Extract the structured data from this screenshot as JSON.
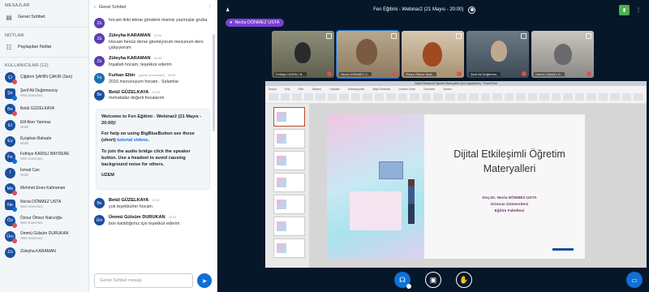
{
  "sidebar": {
    "messages_title": "MESAJLAR",
    "public_chat": "Genel Sohbet",
    "notes_title": "NOTLAR",
    "shared_notes": "Paylaşılan Notlar",
    "users_title": "KULLANICILAR (12)",
    "users": [
      {
        "initials": "Çi",
        "name": "Çiğdem ŞAHİN ÇAKIR (Sen)",
        "role": "",
        "mic": "off",
        "moderator": false
      },
      {
        "initials": "Şe",
        "name": "Şerif Ali Değirmenciy",
        "role": "Web Kamerası",
        "mic": "on",
        "moderator": true
      },
      {
        "initials": "Be",
        "name": "Betül GÜZELKAYA",
        "role": "",
        "mic": "off",
        "moderator": false
      },
      {
        "initials": "El",
        "name": "Elif Aker Yanmaz",
        "role": "Mobil",
        "mic": "",
        "moderator": false
      },
      {
        "initials": "Ey",
        "name": "Eyüphan Bahadır",
        "role": "Mobil",
        "mic": "",
        "moderator": false
      },
      {
        "initials": "Fe",
        "name": "Fethiye KARSLI BAYDERE",
        "role": "Web Kamerası",
        "mic": "on",
        "moderator": false
      },
      {
        "initials": "İ",
        "name": "İsmail Can",
        "role": "Mobil",
        "mic": "",
        "moderator": false
      },
      {
        "initials": "Me",
        "name": "Mehmet Enes Kahraman",
        "role": "",
        "mic": "off",
        "moderator": false
      },
      {
        "initials": "Ne",
        "name": "Necla DÖNMEZ USTA",
        "role": "Web Kamerası",
        "mic": "on",
        "moderator": true
      },
      {
        "initials": "Öz",
        "name": "Öznur Ölmez Nalcıoğlu",
        "role": "Web Kamerası",
        "mic": "off",
        "moderator": false
      },
      {
        "initials": "Üm",
        "name": "Ümmü Gülsüm DURUKAN",
        "role": "Web Kamerası",
        "mic": "off",
        "moderator": false
      },
      {
        "initials": "Zü",
        "name": "Züleyha KARAMAN",
        "role": "",
        "mic": "",
        "moderator": false
      }
    ]
  },
  "chat": {
    "header": "Genel Sohbet",
    "messages": [
      {
        "initials": "Zü",
        "name": "",
        "time": "",
        "text": "hocam linki tekrar gönderir misiniz yazmışlar gruba",
        "avatar_color": "#5b3fb0"
      },
      {
        "initials": "Zü",
        "name": "Züleyha KARAMAN",
        "time": "20:04",
        "text": "Hocam henüz derse giremiyorum mezunum ders çalışıyorum",
        "avatar_color": "#5b3fb0"
      },
      {
        "initials": "Zü",
        "name": "Züleyha KARAMAN",
        "time": "20:05",
        "text": "İnşallah hocam, teşekkür ederim",
        "avatar_color": "#5b3fb0"
      },
      {
        "initials": "Fu",
        "name": "Furkan Elbir",
        "time": "20:05",
        "sub": "(ayrıldı oturumdan)",
        "text": "2016 mezunuyum hocam . Selamlar",
        "avatar_color": "#1b6fb0"
      },
      {
        "initials": "Be",
        "name": "Betül GÜZELKAYA",
        "time": "20:06",
        "text": "mehabalar değerli hocalarım",
        "avatar_color": "#1b4f9e"
      }
    ],
    "welcome": {
      "line1": "Welcome to Fen Eğitimi - Webinar2 (21 Mayıs - 20:00)!",
      "line2a": "For help on using BigBlueButton see these (short) ",
      "line2link": "tutorial videos",
      "line2b": ".",
      "line3": "To join the audio bridge click the speaker button. Use a headset to avoid causing background noise for others.",
      "line4": "UZEM"
    },
    "messages2": [
      {
        "initials": "Be",
        "name": "Betül GÜZELKAYA",
        "time": "20:42",
        "text": "çok teşekkürler hocam",
        "avatar_color": "#1b4f9e"
      },
      {
        "initials": "Üm",
        "name": "Ümmü Gülsüm DURUKAN",
        "time": "20:43",
        "text": "bon katıldığımız için teşekkür ederim",
        "avatar_color": "#1b4f9e"
      }
    ],
    "input_placeholder": "Genel Sohbet mesajı"
  },
  "main": {
    "title": "Fen Eğitimi - Webinar2 (21 Mayıs - 20:00)",
    "talking": "Necla DÖNMEZ USTA",
    "videos": [
      {
        "name": "Fethiye KARSLI B..."
      },
      {
        "name": "Necla DÖNMEZ U..."
      },
      {
        "name": "Öznur Ölmez Nalc..."
      },
      {
        "name": "Şerif Ali Değirmen..."
      },
      {
        "name": "Ümmü Gülsüm D..."
      }
    ],
    "ppt_window_title": "Dijital Etkileşimli Öğretim Materyalleri (son kaydedilen) - PowerPoint",
    "ppt_tabs": [
      "Dosya",
      "Giriş",
      "Ekle",
      "Tasarım",
      "Geçişler",
      "Animasyonlar",
      "Slayt Gösterisi",
      "Gözden Geçir",
      "Görünüm",
      "Yardım"
    ],
    "slide": {
      "title": "Dijital Etkileşimli Öğretim Materyalleri",
      "author": "Doç.Dr. Necla DÖNMEZ USTA",
      "university": "Giresun Üniversitesi",
      "faculty": "Eğitim Fakültesi"
    }
  }
}
